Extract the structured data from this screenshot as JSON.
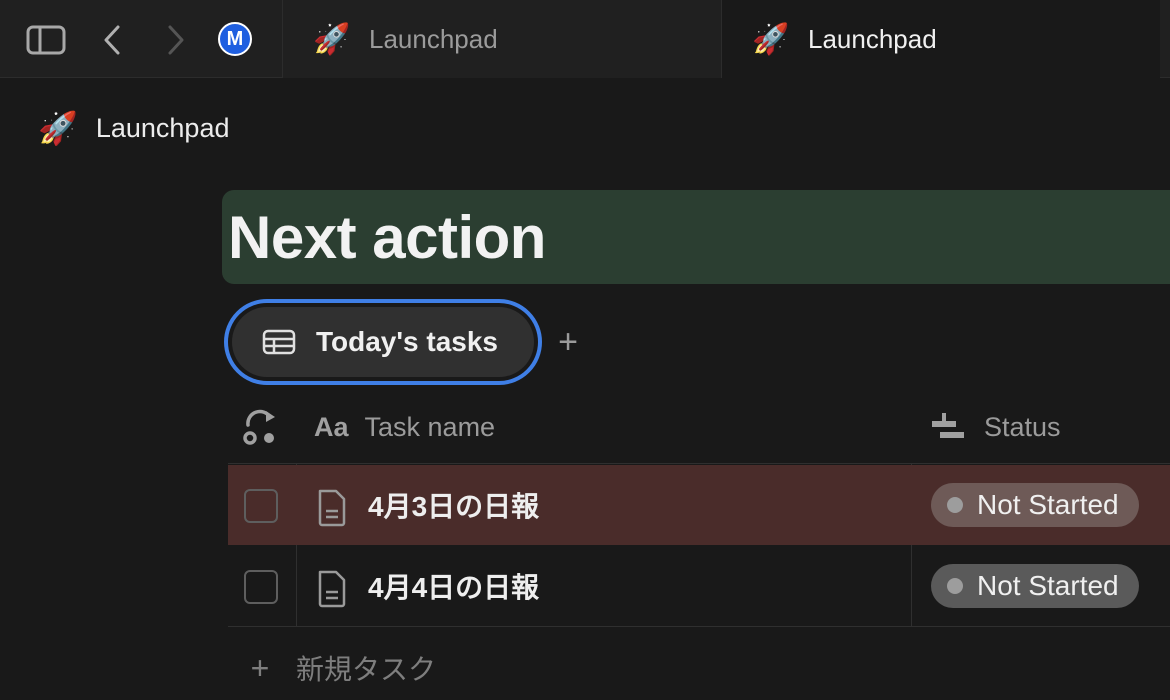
{
  "tabbar": {
    "avatar_letter": "M",
    "tabs": [
      {
        "label": "Launchpad",
        "icon": "rocket-icon",
        "active": false
      },
      {
        "label": "Launchpad",
        "icon": "rocket-icon",
        "active": true
      }
    ]
  },
  "breadcrumb": {
    "label": "Launchpad",
    "icon": "rocket-icon"
  },
  "page": {
    "title": "Next action"
  },
  "view": {
    "tab_label": "Today's tasks",
    "add_symbol": "+"
  },
  "table": {
    "columns": [
      {
        "label": "Task name",
        "icon": "text-type-icon"
      },
      {
        "label": "Status",
        "icon": "status-icon"
      }
    ],
    "rows": [
      {
        "name": "4月3日の日報",
        "status": "Not Started",
        "highlighted": true
      },
      {
        "name": "4月4日の日報",
        "status": "Not Started",
        "highlighted": false
      }
    ],
    "new_row_label": "新規タスク",
    "new_row_symbol": "+"
  },
  "colors": {
    "accent": "#3f7fe6",
    "title_bg": "#2b3e31",
    "highlight_row": "#4a2c2a"
  }
}
